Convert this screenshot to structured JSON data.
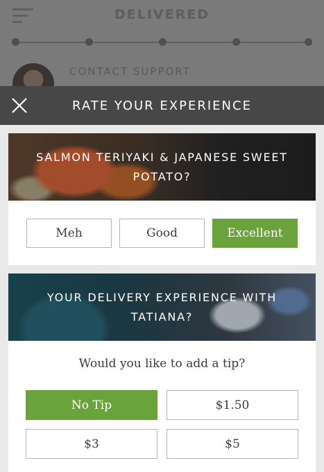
{
  "background": {
    "title": "DELIVERED",
    "contact_support": "CONTACT SUPPORT"
  },
  "modal": {
    "title": "RATE YOUR EXPERIENCE",
    "close_icon": "close-icon"
  },
  "meal": {
    "question": "SALMON TERIYAKI & JAPANESE SWEET POTATO?",
    "options": [
      "Meh",
      "Good",
      "Excellent"
    ],
    "selected": "Excellent"
  },
  "delivery": {
    "question": "YOUR DELIVERY EXPERIENCE WITH TATIANA?",
    "tip_question": "Would you like to add a tip?",
    "tips": [
      "No Tip",
      "$1.50",
      "$3",
      "$5"
    ],
    "selected": "No Tip"
  },
  "colors": {
    "accent": "#6aa23c",
    "header_bg": "#474747",
    "page_bg": "#e9e9e9"
  }
}
